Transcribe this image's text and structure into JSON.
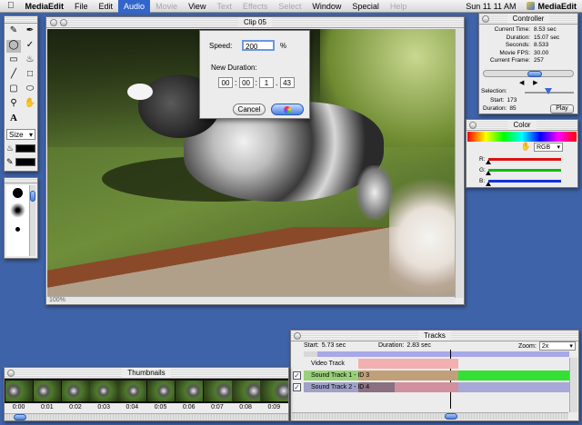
{
  "menubar": {
    "app_name": "MediaEdit",
    "items": [
      {
        "label": "File",
        "state": "normal"
      },
      {
        "label": "Edit",
        "state": "normal"
      },
      {
        "label": "Audio",
        "state": "selected"
      },
      {
        "label": "Movie",
        "state": "disabled"
      },
      {
        "label": "View",
        "state": "normal"
      },
      {
        "label": "Text",
        "state": "disabled"
      },
      {
        "label": "Effects",
        "state": "disabled"
      },
      {
        "label": "Select",
        "state": "disabled"
      },
      {
        "label": "Window",
        "state": "normal"
      },
      {
        "label": "Special",
        "state": "normal"
      },
      {
        "label": "Help",
        "state": "disabled"
      }
    ],
    "clock": "Sun 11 11 AM",
    "app_menu": "MediaEdit"
  },
  "clip_window": {
    "title": "Clip 05",
    "zoom": "100%"
  },
  "speed_dialog": {
    "speed_label": "Speed:",
    "speed_value": "200",
    "speed_unit": "%",
    "duration_label": "New Duration:",
    "duration": [
      "00",
      "00",
      "1",
      "43"
    ],
    "separators": [
      ":",
      ":",
      "."
    ],
    "cancel_label": "Cancel"
  },
  "controller": {
    "title": "Controller",
    "rows": [
      {
        "label": "Current Time:",
        "value": "8.53 sec"
      },
      {
        "label": "Duration:",
        "value": "15.07 sec"
      },
      {
        "label": "Seconds:",
        "value": "8.533"
      },
      {
        "label": "Movie FPS:",
        "value": "30.00"
      },
      {
        "label": "Current Frame:",
        "value": "257"
      }
    ],
    "selection_label": "Selection:",
    "start_label": "Start:",
    "start_value": "173",
    "duration_label": "Duration:",
    "duration_value": "85",
    "play_label": "Play"
  },
  "color_window": {
    "title": "Color",
    "mode": "RGB",
    "channels": [
      {
        "label": "R:",
        "color": "#dd1111"
      },
      {
        "label": "G:",
        "color": "#11bb11"
      },
      {
        "label": "B:",
        "color": "#1133dd"
      }
    ]
  },
  "tools": {
    "size_label": "Size"
  },
  "tracks": {
    "title": "Tracks",
    "start_label": "Start:",
    "start_value": "5.73 sec",
    "duration_label": "Duration:",
    "duration_value": "2.83 sec",
    "zoom_label": "Zoom:",
    "zoom_value": "2x",
    "rows": [
      {
        "name": "Video Track",
        "checked": false
      },
      {
        "name": "Sound Track 1 - ID 3",
        "checked": true
      },
      {
        "name": "Sound Track 2 - ID 4",
        "checked": true
      }
    ]
  },
  "thumbnails": {
    "title": "Thumbnails",
    "times": [
      "0:00",
      "0:01",
      "0:02",
      "0:03",
      "0:04",
      "0:05",
      "0:06",
      "0:07",
      "0:08",
      "0:09"
    ]
  }
}
